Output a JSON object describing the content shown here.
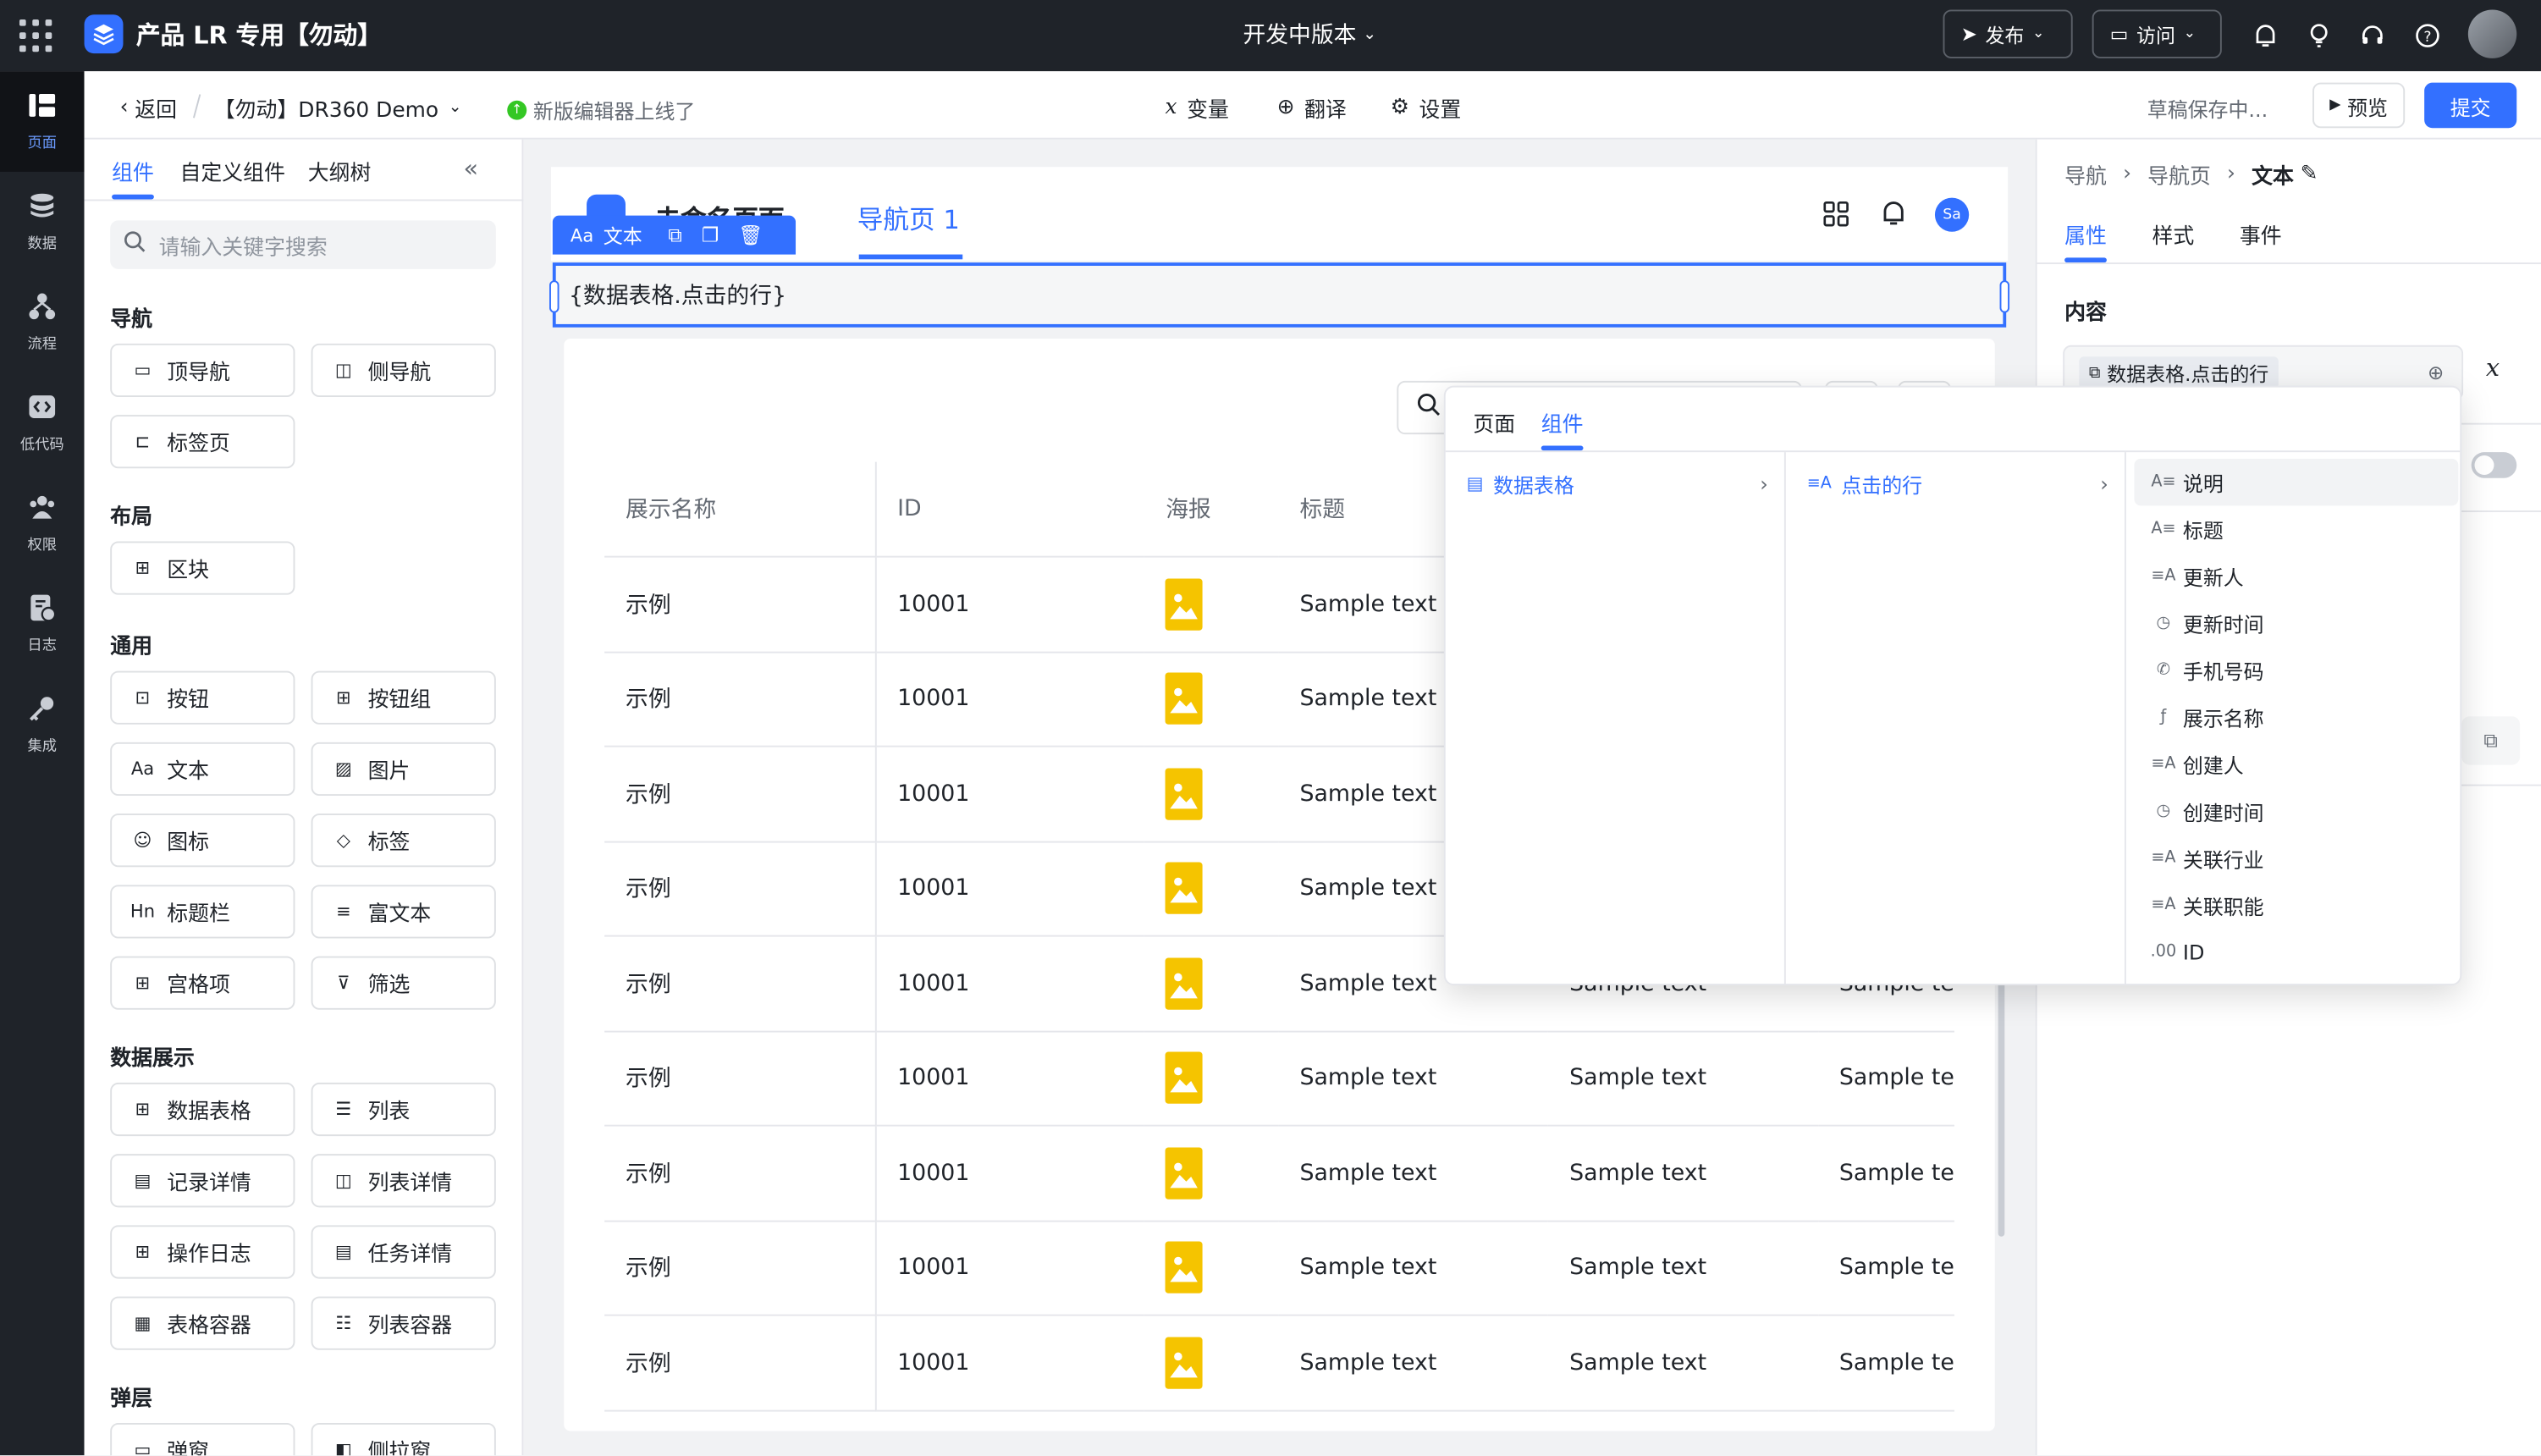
{
  "topbar": {
    "app_title": "产品 LR 专用【勿动】",
    "version": "开发中版本",
    "publish_label": "发布",
    "visit_label": "访问",
    "avatar_text": ""
  },
  "rail": {
    "items": [
      {
        "label": "页面",
        "icon": "page-icon"
      },
      {
        "label": "数据",
        "icon": "database-icon"
      },
      {
        "label": "流程",
        "icon": "flow-icon"
      },
      {
        "label": "低代码",
        "icon": "code-icon"
      },
      {
        "label": "权限",
        "icon": "users-icon"
      },
      {
        "label": "日志",
        "icon": "log-icon"
      },
      {
        "label": "集成",
        "icon": "key-icon"
      }
    ]
  },
  "subbar": {
    "back_label": "返回",
    "page_name": "【勿动】DR360 Demo",
    "notice": "新版编辑器上线了",
    "variables_label": "变量",
    "translate_label": "翻译",
    "settings_label": "设置",
    "draft_status": "草稿保存中...",
    "preview_label": "预览",
    "submit_label": "提交"
  },
  "left_panel": {
    "tabs": [
      "组件",
      "自定义组件",
      "大纲树"
    ],
    "search_placeholder": "请输入关键字搜索",
    "sections": [
      {
        "title": "导航",
        "items": [
          {
            "label": "顶导航",
            "icon": "top-nav-icon"
          },
          {
            "label": "侧导航",
            "icon": "side-nav-icon"
          },
          {
            "label": "标签页",
            "icon": "folder-tab-icon"
          }
        ]
      },
      {
        "title": "布局",
        "items": [
          {
            "label": "区块",
            "icon": "grid-block-icon"
          }
        ]
      },
      {
        "title": "通用",
        "items": [
          {
            "label": "按钮",
            "icon": "button-icon"
          },
          {
            "label": "按钮组",
            "icon": "button-group-icon"
          },
          {
            "label": "文本",
            "icon": "text-icon"
          },
          {
            "label": "图片",
            "icon": "image-icon"
          },
          {
            "label": "图标",
            "icon": "smile-icon"
          },
          {
            "label": "标签",
            "icon": "tag-icon"
          },
          {
            "label": "标题栏",
            "icon": "heading-icon"
          },
          {
            "label": "富文本",
            "icon": "rich-text-icon"
          },
          {
            "label": "宫格项",
            "icon": "grid-item-icon"
          },
          {
            "label": "筛选",
            "icon": "filter-icon"
          }
        ]
      },
      {
        "title": "数据展示",
        "items": [
          {
            "label": "数据表格",
            "icon": "table-icon"
          },
          {
            "label": "列表",
            "icon": "list-icon"
          },
          {
            "label": "记录详情",
            "icon": "record-icon"
          },
          {
            "label": "列表详情",
            "icon": "list-detail-icon"
          },
          {
            "label": "操作日志",
            "icon": "log-table-icon"
          },
          {
            "label": "任务详情",
            "icon": "task-icon"
          },
          {
            "label": "表格容器",
            "icon": "table-container-icon"
          },
          {
            "label": "列表容器",
            "icon": "list-container-icon"
          }
        ]
      },
      {
        "title": "弹层",
        "items": [
          {
            "label": "弹窗",
            "icon": "modal-icon"
          },
          {
            "label": "侧拉窗",
            "icon": "drawer-icon"
          }
        ]
      }
    ]
  },
  "canvas": {
    "page_title": "未命名页面",
    "nav_tab": "导航页 1",
    "avatar": "Sa",
    "toolbar_label": "文本",
    "text_binding": "{数据表格.点击的行}",
    "table": {
      "columns": [
        "展示名称",
        "ID",
        "海报",
        "标题",
        "",
        ""
      ],
      "rows": [
        [
          "示例",
          "10001",
          "Sample text",
          "Sample text",
          "Sample te"
        ],
        [
          "示例",
          "10001",
          "Sample text",
          "Sample text",
          "Sample te"
        ],
        [
          "示例",
          "10001",
          "Sample text",
          "Sample text",
          "Sample te"
        ],
        [
          "示例",
          "10001",
          "Sample text",
          "Sample text",
          "Sample te"
        ],
        [
          "示例",
          "10001",
          "Sample text",
          "Sample text",
          "Sample te"
        ],
        [
          "示例",
          "10001",
          "Sample text",
          "Sample text",
          "Sample te"
        ],
        [
          "示例",
          "10001",
          "Sample text",
          "Sample text",
          "Sample te"
        ],
        [
          "示例",
          "10001",
          "Sample text",
          "Sample text",
          "Sample te"
        ],
        [
          "示例",
          "10001",
          "Sample text",
          "Sample text",
          "Sample te"
        ]
      ]
    }
  },
  "right_panel": {
    "breadcrumb": [
      "导航",
      "导航页",
      "文本"
    ],
    "tabs": [
      "属性",
      "样式",
      "事件"
    ],
    "content_label": "内容",
    "binding_chip": "数据表格.点击的行"
  },
  "dropdown": {
    "tabs": [
      "页面",
      "组件"
    ],
    "col1": [
      "数据表格"
    ],
    "col2": [
      "点击的行"
    ],
    "fields": [
      {
        "label": "说明",
        "icon": "A≡"
      },
      {
        "label": "标题",
        "icon": "A≡"
      },
      {
        "label": "更新人",
        "icon": "≡A"
      },
      {
        "label": "更新时间",
        "icon": "◷"
      },
      {
        "label": "手机号码",
        "icon": "✆"
      },
      {
        "label": "展示名称",
        "icon": "ƒ"
      },
      {
        "label": "创建人",
        "icon": "≡A"
      },
      {
        "label": "创建时间",
        "icon": "◷"
      },
      {
        "label": "关联行业",
        "icon": "≡A"
      },
      {
        "label": "关联职能",
        "icon": "≡A"
      },
      {
        "label": "ID",
        "icon": ".00"
      }
    ]
  },
  "colors": {
    "accent": "#3370ff",
    "dark": "#1f2329",
    "poster": "#f5c400"
  }
}
